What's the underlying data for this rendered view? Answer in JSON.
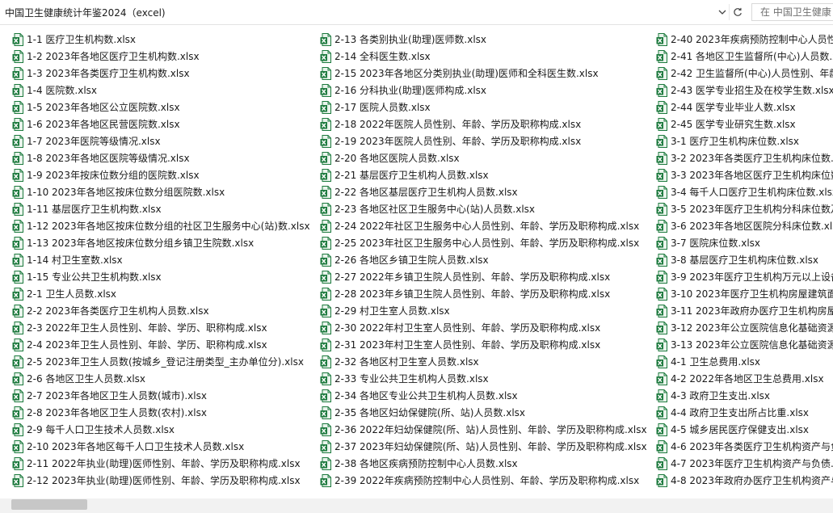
{
  "address_bar": {
    "path": "中国卫生健康统计年鉴2024（excel)",
    "search_placeholder": "在 中国卫生健康"
  },
  "icons": {
    "dropdown": "chevron-down-icon",
    "refresh": "refresh-icon",
    "file": "excel-file-icon"
  },
  "colors": {
    "excel_green": "#1d7a3e",
    "icon_light_green": "#e9f4ec",
    "scroll_thumb": "#c7c7c7"
  },
  "files": {
    "column1": [
      "1-1 医疗卫生机构数.xlsx",
      "1-2 2023年各地区医疗卫生机构数.xlsx",
      "1-3 2023年各类医疗卫生机构数.xlsx",
      "1-4 医院数.xlsx",
      "1-5 2023年各地区公立医院数.xlsx",
      "1-6 2023年各地区民营医院数.xlsx",
      "1-7 2023年医院等级情况.xlsx",
      "1-8 2023年各地区医院等级情况.xlsx",
      "1-9 2023年按床位数分组的医院数.xlsx",
      "1-10 2023年各地区按床位数分组医院数.xlsx",
      "1-11 基层医疗卫生机构数.xlsx",
      "1-12 2023年各地区按床位数分组的社区卫生服务中心(站)数.xlsx",
      "1-13 2023年各地区按床位数分组乡镇卫生院数.xlsx",
      "1-14 村卫生室数.xlsx",
      "1-15 专业公共卫生机构数.xlsx",
      "2-1 卫生人员数.xlsx",
      "2-2 2023年各类医疗卫生机构人员数.xlsx",
      "2-3 2022年卫生人员性别、年龄、学历、职称构成.xlsx",
      "2-4 2023年卫生人员性别、年龄、学历、职称构成.xlsx",
      "2-5 2023年卫生人员数(按城乡_登记注册类型_主办单位分).xlsx",
      "2-6 各地区卫生人员数.xlsx",
      "2-7 2023年各地区卫生人员数(城市).xlsx",
      "2-8 2023年各地区卫生人员数(农村).xlsx",
      "2-9 每千人口卫生技术人员数.xlsx",
      "2-10 2023年各地区每千人口卫生技术人员数.xlsx",
      "2-11 2022年执业(助理)医师性别、年龄、学历及职称构成.xlsx",
      "2-12 2023年执业(助理)医师性别、年龄、学历及职称构成.xlsx"
    ],
    "column2": [
      "2-13 各类别执业(助理)医师数.xlsx",
      "2-14 全科医生数.xlsx",
      "2-15 2023年各地区分类别执业(助理)医师和全科医生数.xlsx",
      "2-16 分科执业(助理)医师构成.xlsx",
      "2-17 医院人员数.xlsx",
      "2-18 2022年医院人员性别、年龄、学历及职称构成.xlsx",
      "2-19 2023年医院人员性别、年龄、学历及职称构成.xlsx",
      "2-20 各地区医院人员数.xlsx",
      "2-21 基层医疗卫生机构人员数.xlsx",
      "2-22 各地区基层医疗卫生机构人员数.xlsx",
      "2-23 各地区社区卫生服务中心(站)人员数.xlsx",
      "2-24 2022年社区卫生服务中心人员性别、年龄、学历及职称构成.xlsx",
      "2-25 2023年社区卫生服务中心人员性别、年龄、学历及职称构成.xlsx",
      "2-26 各地区乡镇卫生院人员数.xlsx",
      "2-27 2022年乡镇卫生院人员性别、年龄、学历及职称构成.xlsx",
      "2-28 2023年乡镇卫生院人员性别、年龄、学历及职称构成.xlsx",
      "2-29 村卫生室人员数.xlsx",
      "2-30 2022年村卫生室人员性别、年龄、学历及职称构成.xlsx",
      "2-31 2023年村卫生室人员性别、年龄、学历及职称构成.xlsx",
      "2-32 各地区村卫生室人员数.xlsx",
      "2-33 专业公共卫生机构人员数.xlsx",
      "2-34 各地区专业公共卫生机构人员数.xlsx",
      "2-35 各地区妇幼保健院(所、站)人员数.xlsx",
      "2-36 2022年妇幼保健院(所、站)人员性别、年龄、学历及职称构成.xlsx",
      "2-37 2023年妇幼保健院(所、站)人员性别、年龄、学历及职称构成.xlsx",
      "2-38 各地区疾病预防控制中心人员数.xlsx",
      "2-39 2022年疾病预防控制中心人员性别、年龄、学历及职称构成.xlsx"
    ],
    "column3": [
      "2-40 2023年疾病预防控制中心人员性",
      "2-41 各地区卫生监督所(中心)人员数.x",
      "2-42 卫生监督所(中心)人员性别、年龄",
      "2-43 医学专业招生及在校学生数.xlsx",
      "2-44 医学专业毕业人数.xlsx",
      "2-45 医学专业研究生数.xlsx",
      "3-1 医疗卫生机构床位数.xlsx",
      "3-2 2023年各类医疗卫生机构床位数.x",
      "3-3 2023年各地区医疗卫生机构床位数",
      "3-4 每千人口医疗卫生机构床位数.xlsx",
      "3-5 2023年医疗卫生机构分科床位数及",
      "3-6 2023年各地区医院分科床位数.xlsx",
      "3-7 医院床位数.xlsx",
      "3-8 基层医疗卫生机构床位数.xlsx",
      "3-9 2023年医疗卫生机构万元以上设备",
      "3-10 2023年医疗卫生机构房屋建筑面",
      "3-11 2023年政府办医疗卫生机构房屋",
      "3-12 2023年公立医院信息化基础资源",
      "3-13 2023年公立医院信息化基础资源",
      "4-1 卫生总费用.xlsx",
      "4-2 2022年各地区卫生总费用.xlsx",
      "4-3 政府卫生支出.xlsx",
      "4-4 政府卫生支出所占比重.xlsx",
      "4-5 城乡居民医疗保健支出.xlsx",
      "4-6 2023年各类医疗卫生机构资产与负",
      "4-7 2023年医疗卫生机构资产与负债.x",
      "4-8 2023年政府办医疗卫生机构资产与"
    ]
  }
}
